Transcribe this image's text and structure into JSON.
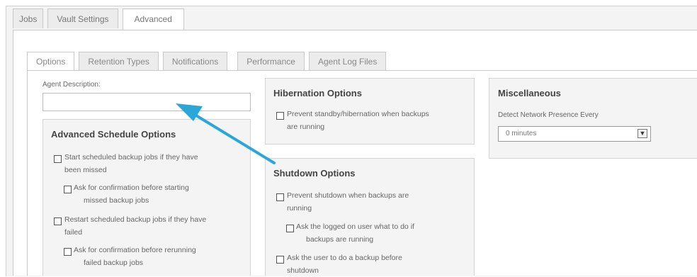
{
  "top_tabs": [
    "Jobs",
    "Vault Settings",
    "Advanced"
  ],
  "sub_tabs": [
    "Options",
    "Retention Types",
    "Notifications",
    "Performance",
    "Agent Log Files"
  ],
  "agent_description": {
    "label": "Agent Description:",
    "value": ""
  },
  "advanced_schedule": {
    "title": "Advanced Schedule Options",
    "options": [
      {
        "line1": "Start scheduled backup jobs if they have",
        "line2": "been missed"
      },
      {
        "line1": "Ask for confirmation before starting",
        "line2": "missed backup jobs"
      },
      {
        "line1": "Restart scheduled backup jobs if they have",
        "line2": "failed"
      },
      {
        "line1": "Ask for confirmation before rerunning",
        "line2": "failed backup jobs"
      }
    ]
  },
  "hibernation": {
    "title": "Hibernation Options",
    "options": [
      {
        "line1": "Prevent standby/hibernation when backups",
        "line2": "are running"
      }
    ]
  },
  "shutdown": {
    "title": "Shutdown Options",
    "options": [
      {
        "line1": "Prevent shutdown when backups are",
        "line2": "running"
      },
      {
        "line1": "Ask the logged on user what to do if",
        "line2": "backups are running"
      },
      {
        "line1": "Ask the user to do a backup before",
        "line2": "shutdown"
      }
    ]
  },
  "miscellaneous": {
    "title": "Miscellaneous",
    "detect_label": "Detect Network Presence Every",
    "detect_value": "0 minutes"
  },
  "icons": {
    "dropdown": "chevron-down-icon",
    "annotation": "arrow-icon"
  },
  "colors": {
    "annotation_arrow": "#2aa7d8"
  }
}
